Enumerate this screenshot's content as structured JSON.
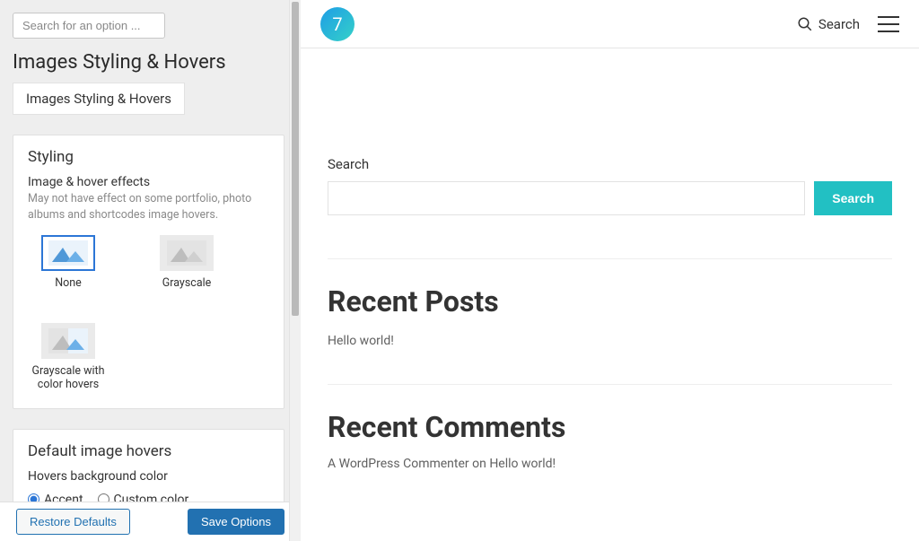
{
  "sidebar": {
    "search_placeholder": "Search for an option ...",
    "title": "Images Styling & Hovers",
    "tab_label": "Images Styling & Hovers",
    "styling_card": {
      "heading": "Styling",
      "sub_label": "Image & hover effects",
      "hint": "May not have effect on some portfolio, photo albums and shortcodes image hovers.",
      "options": [
        {
          "label": "None",
          "selected": true
        },
        {
          "label": "Grayscale",
          "selected": false
        },
        {
          "label": "Grayscale with color hovers",
          "selected": false
        }
      ]
    },
    "hovers_card": {
      "heading": "Default image hovers",
      "sub_label": "Hovers background color",
      "radios": [
        {
          "label": "Accent",
          "checked": true
        },
        {
          "label": "Custom color",
          "checked": false
        }
      ]
    },
    "footer": {
      "restore": "Restore Defaults",
      "save": "Save Options"
    }
  },
  "preview": {
    "brand_text": "7",
    "header_search_label": "Search",
    "search_section_label": "Search",
    "search_button": "Search",
    "recent_posts_heading": "Recent Posts",
    "recent_posts_item": "Hello world!",
    "recent_comments_heading": "Recent Comments",
    "recent_comment_line": "A WordPress Commenter on Hello world!"
  }
}
